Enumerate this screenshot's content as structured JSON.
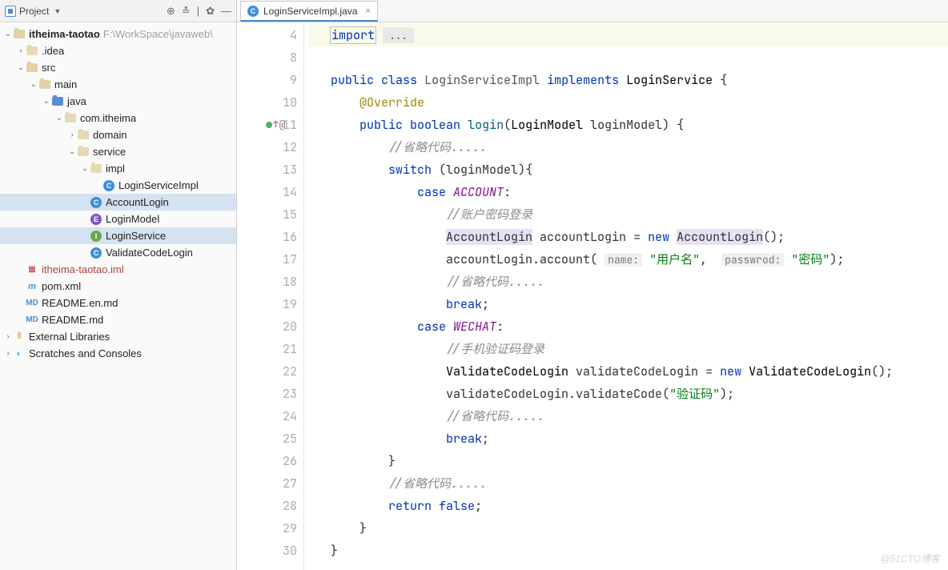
{
  "sidebar": {
    "title": "Project",
    "root": {
      "name": "itheima-taotao",
      "path": "F:\\WorkSpace\\javaweb\\"
    },
    "tree_labels": {
      "idea": ".idea",
      "src": "src",
      "main": "main",
      "java": "java",
      "pkg": "com.itheima",
      "domain": "domain",
      "service": "service",
      "impl": "impl",
      "loginServiceImpl": "LoginServiceImpl",
      "accountLogin": "AccountLogin",
      "loginModel": "LoginModel",
      "loginService": "LoginService",
      "validateCodeLogin": "ValidateCodeLogin",
      "iml": "itheima-taotao.iml",
      "pom": "pom.xml",
      "readmeEn": "README.en.md",
      "readme": "README.md",
      "external": "External Libraries",
      "scratches": "Scratches and Consoles"
    }
  },
  "tab": {
    "file": "LoginServiceImpl.java"
  },
  "gutter": {
    "lines": [
      "4",
      "8",
      "9",
      "10",
      "11",
      "12",
      "13",
      "14",
      "15",
      "16",
      "17",
      "18",
      "19",
      "20",
      "21",
      "22",
      "23",
      "24",
      "25",
      "26",
      "27",
      "28",
      "29",
      "30"
    ]
  },
  "code": {
    "import": "import",
    "public": "public",
    "class": "class",
    "className": "LoginServiceImpl",
    "implements": "implements",
    "iface": "LoginService",
    "override": "@Override",
    "boolean": "boolean",
    "method": "login",
    "paramType": "LoginModel",
    "paramName": "loginModel",
    "comment_omit": "//省略代码.....",
    "switch": "switch",
    "case": "case",
    "ACCOUNT": "ACCOUNT",
    "WECHAT": "WECHAT",
    "comment_account": "//账户密码登录",
    "comment_wechat": "//手机验证码登录",
    "new": "new",
    "AccountLogin": "AccountLogin",
    "accountLoginVar": "accountLogin",
    "accountMethod": "account",
    "hint_name": "name:",
    "hint_pass": "passwrod:",
    "str_user": "\"用户名\"",
    "str_pass": "\"密码\"",
    "break": "break",
    "ValidateCodeLogin": "ValidateCodeLogin",
    "vclVar": "validateCodeLogin",
    "vclMethod": "validateCode",
    "str_code": "\"验证码\"",
    "return": "return",
    "false": "false"
  },
  "watermark": "@51CTO博客"
}
